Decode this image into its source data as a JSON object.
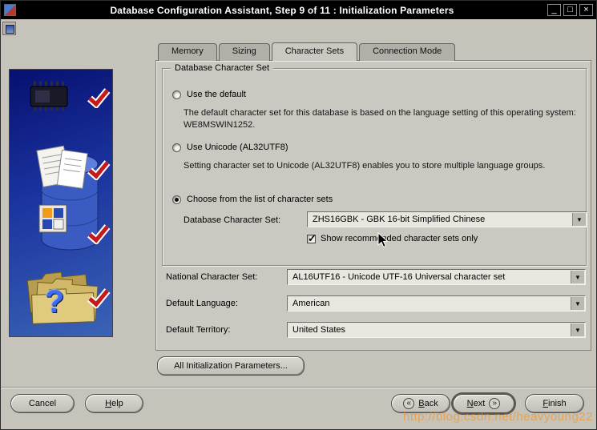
{
  "window": {
    "title": "Database Configuration Assistant, Step 9 of 11 : Initialization Parameters",
    "minimize_glyph": "_",
    "maximize_glyph": "□",
    "close_glyph": "×"
  },
  "tabs": [
    {
      "label": "Memory"
    },
    {
      "label": "Sizing"
    },
    {
      "label": "Character Sets"
    },
    {
      "label": "Connection Mode"
    }
  ],
  "charset_group": {
    "title": "Database Character Set",
    "option_default": {
      "label": "Use the default",
      "description": "The default character set for this database is based on the language setting of this operating system: WE8MSWIN1252."
    },
    "option_unicode": {
      "label": "Use Unicode (AL32UTF8)",
      "description": "Setting character set to Unicode (AL32UTF8) enables you to store multiple language groups."
    },
    "option_list": {
      "label": "Choose from the list of character sets"
    },
    "db_charset_label": "Database Character Set:",
    "db_charset_value": "ZHS16GBK - GBK 16-bit Simplified Chinese",
    "show_recommended_label": "Show recommended character sets only"
  },
  "fields": {
    "national": {
      "label": "National Character Set:",
      "value": "AL16UTF16 - Unicode UTF-16 Universal character set"
    },
    "language": {
      "label": "Default Language:",
      "value": "American"
    },
    "territory": {
      "label": "Default Territory:",
      "value": "United States"
    }
  },
  "all_params_label": "All Initialization Parameters...",
  "footer": {
    "cancel": "Cancel",
    "help": "Help",
    "back": "Back",
    "next": "Next",
    "finish": "Finish",
    "back_chevron": "«",
    "next_chevron": "»"
  },
  "watermark": "http://blog.csdn.net/heavyoung22"
}
